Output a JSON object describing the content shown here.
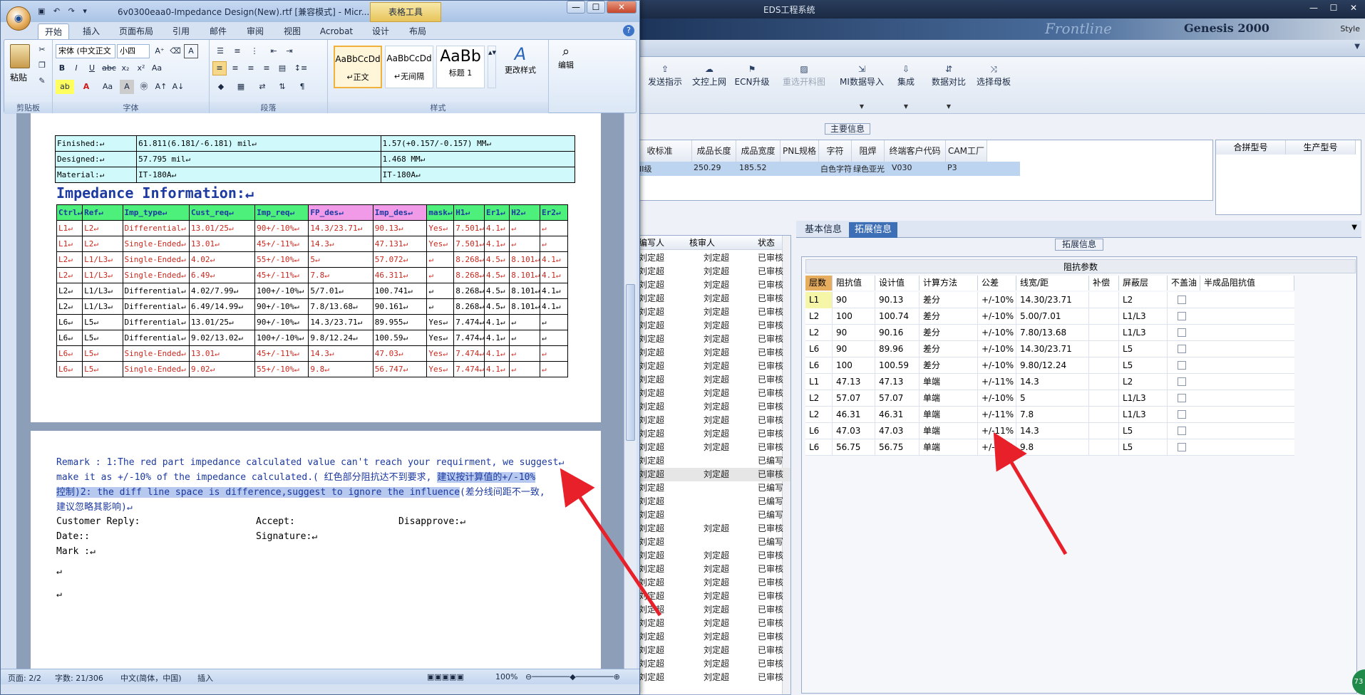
{
  "eds": {
    "title": "EDS工程系统",
    "banner_brand": "Frontline",
    "banner_product": "Genesis 2000",
    "banner_style": "Style",
    "toolbar": [
      {
        "label": "查",
        "icon": "",
        "disabled": false
      },
      {
        "label": "发送指示",
        "icon": "upload-icon",
        "disabled": false
      },
      {
        "label": "文控上网",
        "icon": "cloud-icon",
        "disabled": false
      },
      {
        "label": "ECN升级",
        "icon": "ecn-icon",
        "disabled": false
      },
      {
        "label": "重选开料图",
        "icon": "image-icon",
        "disabled": true
      },
      {
        "label": "MI数据导入",
        "icon": "import-icon",
        "disabled": false
      },
      {
        "label": "集成",
        "icon": "download-icon",
        "disabled": false
      },
      {
        "label": "数据对比",
        "icon": "compare-icon",
        "disabled": false
      },
      {
        "label": "选择母板",
        "icon": "shuffle-icon",
        "disabled": false
      }
    ],
    "main_info_label": "主要信息",
    "main_grid": {
      "headers": [
        "收标准",
        "成品长度",
        "成品宽度",
        "PNL规格",
        "字符",
        "阻焊",
        "终端客户代码",
        "CAM工厂"
      ],
      "row": [
        "II级",
        "250.29",
        "185.52",
        "",
        "白色字符",
        "绿色亚光",
        "V030",
        "P3"
      ]
    },
    "side_grid_headers": [
      "合拼型号",
      "生产型号"
    ],
    "list": {
      "headers": [
        "编写人",
        "核审人",
        "状态"
      ],
      "rows": [
        [
          "刘定超",
          "刘定超",
          "已审核"
        ],
        [
          "刘定超",
          "刘定超",
          "已审核"
        ],
        [
          "刘定超",
          "刘定超",
          "已审核"
        ],
        [
          "刘定超",
          "刘定超",
          "已审核"
        ],
        [
          "刘定超",
          "刘定超",
          "已审核"
        ],
        [
          "刘定超",
          "刘定超",
          "已审核"
        ],
        [
          "刘定超",
          "刘定超",
          "已审核"
        ],
        [
          "刘定超",
          "刘定超",
          "已审核"
        ],
        [
          "刘定超",
          "刘定超",
          "已审核"
        ],
        [
          "刘定超",
          "刘定超",
          "已审核"
        ],
        [
          "刘定超",
          "刘定超",
          "已审核"
        ],
        [
          "刘定超",
          "刘定超",
          "已审核"
        ],
        [
          "刘定超",
          "刘定超",
          "已审核"
        ],
        [
          "刘定超",
          "刘定超",
          "已审核"
        ],
        [
          "刘定超",
          "刘定超",
          "已审核"
        ],
        [
          "刘定超",
          "",
          "已编写"
        ],
        [
          "刘定超",
          "刘定超",
          "已审核"
        ],
        [
          "刘定超",
          "",
          "已编写"
        ],
        [
          "刘定超",
          "",
          "已编写"
        ],
        [
          "刘定超",
          "",
          "已编写"
        ],
        [
          "刘定超",
          "刘定超",
          "已审核"
        ],
        [
          "刘定超",
          "",
          "已编写"
        ],
        [
          "刘定超",
          "刘定超",
          "已审核"
        ],
        [
          "刘定超",
          "刘定超",
          "已审核"
        ],
        [
          "刘定超",
          "刘定超",
          "已审核"
        ],
        [
          "刘定超",
          "刘定超",
          "已审核"
        ],
        [
          "刘定超",
          "刘定超",
          "已审核"
        ],
        [
          "刘定超",
          "刘定超",
          "已审核"
        ],
        [
          "刘定超",
          "刘定超",
          "已审核"
        ],
        [
          "刘定超",
          "刘定超",
          "已审核"
        ],
        [
          "刘定超",
          "刘定超",
          "已审核"
        ],
        [
          "刘定超",
          "刘定超",
          "已审核"
        ]
      ],
      "selected_index": 16
    },
    "tabs": [
      "基本信息",
      "拓展信息"
    ],
    "active_tab": 1,
    "ext_label": "拓展信息",
    "imp_title": "阻抗参数",
    "imp_headers": [
      "层数",
      "阻抗值",
      "设计值",
      "计算方法",
      "公差",
      "线宽/距",
      "补偿",
      "屏蔽层",
      "不盖油",
      "半成品阻抗值"
    ],
    "imp_rows": [
      [
        "L1",
        "90",
        "90.13",
        "差分",
        "+/-10%",
        "14.30/23.71",
        "",
        "L2"
      ],
      [
        "L2",
        "100",
        "100.74",
        "差分",
        "+/-10%",
        "5.00/7.01",
        "",
        "L1/L3"
      ],
      [
        "L2",
        "90",
        "90.16",
        "差分",
        "+/-10%",
        "7.80/13.68",
        "",
        "L1/L3"
      ],
      [
        "L6",
        "90",
        "89.96",
        "差分",
        "+/-10%",
        "14.30/23.71",
        "",
        "L5"
      ],
      [
        "L6",
        "100",
        "100.59",
        "差分",
        "+/-10%",
        "9.80/12.24",
        "",
        "L5"
      ],
      [
        "L1",
        "47.13",
        "47.13",
        "单端",
        "+/-11%",
        "14.3",
        "",
        "L2"
      ],
      [
        "L2",
        "57.07",
        "57.07",
        "单端",
        "+/-10%",
        "5",
        "",
        "L1/L3"
      ],
      [
        "L2",
        "46.31",
        "46.31",
        "单端",
        "+/-11%",
        "7.8",
        "",
        "L1/L3"
      ],
      [
        "L6",
        "47.03",
        "47.03",
        "单端",
        "+/-11%",
        "14.3",
        "",
        "L5"
      ],
      [
        "L6",
        "56.75",
        "56.75",
        "单端",
        "+/-10%",
        "9.8",
        "",
        "L5"
      ]
    ],
    "corner_badge": "73"
  },
  "word": {
    "title": "6v0300eaa0-Impedance Design(New).rtf [兼容模式] - Micr...",
    "table_tools": "表格工具",
    "tabs": [
      "开始",
      "插入",
      "页面布局",
      "引用",
      "邮件",
      "审阅",
      "视图",
      "Acrobat",
      "设计",
      "布局"
    ],
    "ribbon": {
      "paste": "粘贴",
      "clipboard": "剪贴板",
      "font_name": "宋体 (中文正文",
      "font_size": "小四",
      "font_group": "字体",
      "paragraph_group": "段落",
      "styles_group": "样式",
      "styles": [
        {
          "preview": "AaBbCcDd",
          "name": "↵正文"
        },
        {
          "preview": "AaBbCcDd",
          "name": "↵无间隔"
        },
        {
          "preview": "AaBb",
          "name": "标题 1"
        }
      ],
      "change_styles": "更改样式",
      "edit": "编辑"
    },
    "top_table": [
      [
        "Finished:↵",
        "61.811(6.181/-6.181) mil↵",
        "1.57(+0.157/-0.157) MM↵"
      ],
      [
        "Designed:↵",
        "57.795 mil↵",
        "1.468 MM↵"
      ],
      [
        "Material:↵",
        "IT-180A↵",
        "IT-180A↵"
      ]
    ],
    "imp_heading": "Impedance Information:↵",
    "imp_headers": [
      "Ctrl↵",
      "Ref↵",
      "Imp_type↵",
      "Cust_req↵",
      "Imp_req↵",
      "FP_des↵",
      "Imp_des↵",
      "mask↵",
      "H1↵",
      "Er1↵",
      "H2↵",
      "Er2↵"
    ],
    "imp_rows": [
      {
        "red": true,
        "cells": [
          "L1↵",
          "L2↵",
          "Differential↵",
          "13.01/25↵",
          "90+/-10%↵",
          "14.3/23.71↵",
          "90.13↵",
          "Yes↵",
          "7.501↵",
          "4.1↵",
          "↵",
          "↵"
        ]
      },
      {
        "red": true,
        "cells": [
          "L1↵",
          "L2↵",
          "Single-Ended↵",
          "13.01↵",
          "45+/-11%↵",
          "14.3↵",
          "47.131↵",
          "Yes↵",
          "7.501↵",
          "4.1↵",
          "↵",
          "↵"
        ]
      },
      {
        "red": true,
        "cells": [
          "L2↵",
          "L1/L3↵",
          "Single-Ended↵",
          "4.02↵",
          "55+/-10%↵",
          "5↵",
          "57.072↵",
          "↵",
          "8.268↵",
          "4.5↵",
          "8.101↵",
          "4.1↵"
        ]
      },
      {
        "red": true,
        "cells": [
          "L2↵",
          "L1/L3↵",
          "Single-Ended↵",
          "6.49↵",
          "45+/-11%↵",
          "7.8↵",
          "46.311↵",
          "↵",
          "8.268↵",
          "4.5↵",
          "8.101↵",
          "4.1↵"
        ]
      },
      {
        "red": false,
        "cells": [
          "L2↵",
          "L1/L3↵",
          "Differential↵",
          "4.02/7.99↵",
          "100+/-10%↵",
          "5/7.01↵",
          "100.741↵",
          "↵",
          "8.268↵",
          "4.5↵",
          "8.101↵",
          "4.1↵"
        ]
      },
      {
        "red": false,
        "cells": [
          "L2↵",
          "L1/L3↵",
          "Differential↵",
          "6.49/14.99↵",
          "90+/-10%↵",
          "7.8/13.68↵",
          "90.161↵",
          "↵",
          "8.268↵",
          "4.5↵",
          "8.101↵",
          "4.1↵"
        ]
      },
      {
        "red": false,
        "cells": [
          "L6↵",
          "L5↵",
          "Differential↵",
          "13.01/25↵",
          "90+/-10%↵",
          "14.3/23.71↵",
          "89.955↵",
          "Yes↵",
          "7.474↵",
          "4.1↵",
          "↵",
          "↵"
        ]
      },
      {
        "red": false,
        "cells": [
          "L6↵",
          "L5↵",
          "Differential↵",
          "9.02/13.02↵",
          "100+/-10%↵",
          "9.8/12.24↵",
          "100.59↵",
          "Yes↵",
          "7.474↵",
          "4.1↵",
          "↵",
          "↵"
        ]
      },
      {
        "red": true,
        "cells": [
          "L6↵",
          "L5↵",
          "Single-Ended↵",
          "13.01↵",
          "45+/-11%↵",
          "14.3↵",
          "47.03↵",
          "Yes↵",
          "7.474↵",
          "4.1↵",
          "↵",
          "↵"
        ]
      },
      {
        "red": true,
        "cells": [
          "L6↵",
          "L5↵",
          "Single-Ended↵",
          "9.02↵",
          "55+/-10%↵",
          "9.8↵",
          "56.747↵",
          "Yes↵",
          "7.474↵",
          "4.1↵",
          "↵",
          "↵"
        ]
      }
    ],
    "remark_1a": "Remark : 1:The red part impedance calculated  value can't reach your requirment, we suggest↵",
    "remark_2a": "make it as +/-10% of the impedance calculated.( 红色部分阻抗达不到要求, ",
    "remark_2b": "建议按计算值的+/-10%",
    "remark_3a": "控制)2: the diff line space is difference,suggest to ignore the influence",
    "remark_3b": "(差分线间距不一致,",
    "remark_4": "建议忽略其影响)↵",
    "customer_reply": "Customer Reply:",
    "accept": "Accept:",
    "disapprove": "Disapprove:↵",
    "date": "Date::",
    "signature": "Signature:↵",
    "mark": "Mark :↵",
    "status": {
      "page": "页面: 2/2",
      "words": "字数: 21/306",
      "lang": "中文(简体，中国)",
      "insert": "插入",
      "zoom": "100%"
    }
  },
  "colors": {
    "arrow": "#e8202a",
    "active_tab": "#3d6fb6",
    "table_header": "#4cf07a"
  }
}
